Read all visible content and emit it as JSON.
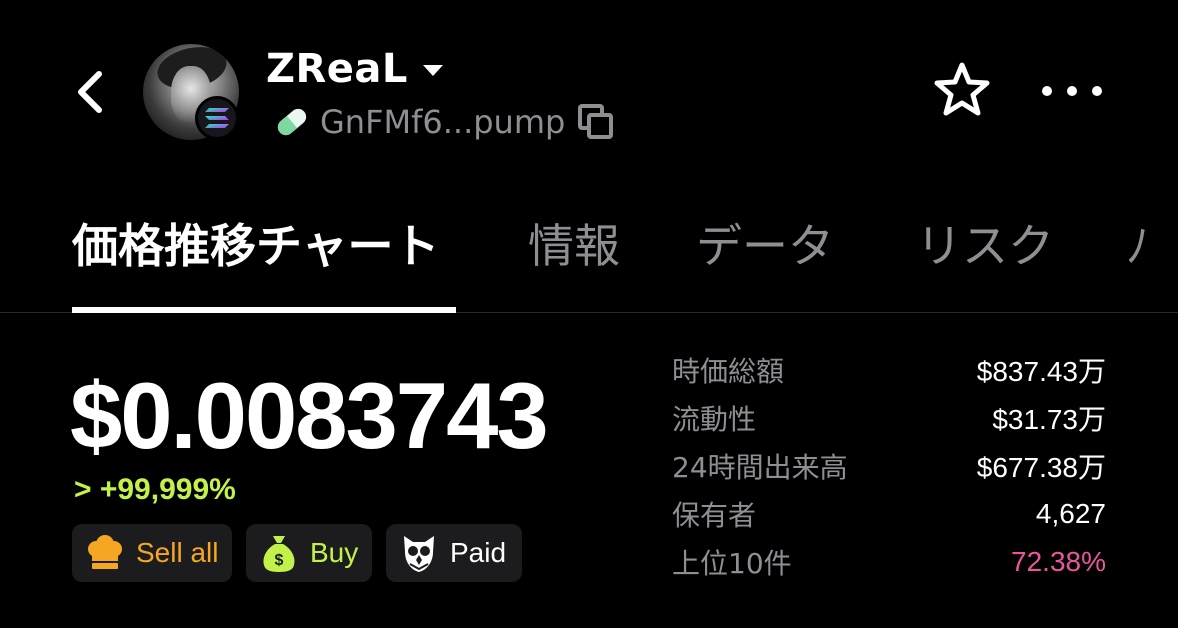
{
  "header": {
    "back_icon": "chevron-left-icon",
    "token_name": "ZReaL",
    "chain_badge_icon": "solana-icon",
    "address_icon": "pill-icon",
    "address": "GnFMf6...pump",
    "copy_icon": "copy-icon",
    "favorite_icon": "star-outline-icon",
    "more_icon": "more-horizontal-icon"
  },
  "tabs": [
    {
      "label": "価格推移チャート",
      "active": true
    },
    {
      "label": "情報",
      "active": false
    },
    {
      "label": "データ",
      "active": false
    },
    {
      "label": "リスク",
      "active": false
    },
    {
      "label": "ﾉ",
      "active": false
    }
  ],
  "price": {
    "value": "$0.0083743",
    "change": "> +99,999%",
    "change_color": "#c2f24a"
  },
  "actions": [
    {
      "label": "Sell all",
      "icon": "chef-hat-icon",
      "color": "#f5a623"
    },
    {
      "label": "Buy",
      "icon": "money-bag-icon",
      "color": "#c2f24a"
    },
    {
      "label": "Paid",
      "icon": "owl-icon",
      "color": "#ffffff"
    }
  ],
  "stats": [
    {
      "label": "時価総額",
      "value": "$837.43万"
    },
    {
      "label": "流動性",
      "value": "$31.73万"
    },
    {
      "label": "24時間出来高",
      "value": "$677.38万"
    },
    {
      "label": "保有者",
      "value": "4,627"
    },
    {
      "label": "上位10件",
      "value": "72.38%",
      "color": "#e8579b"
    }
  ]
}
